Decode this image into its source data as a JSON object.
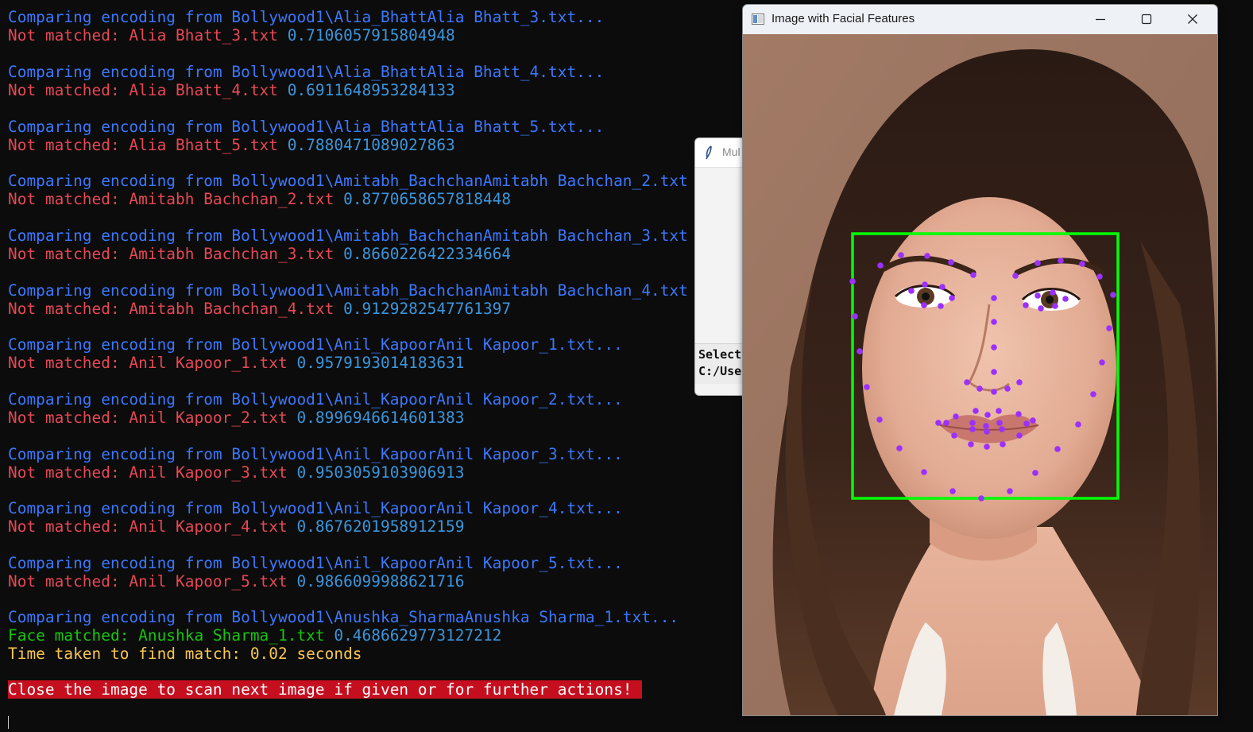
{
  "terminal": {
    "lines": [
      {
        "label": "Comparing encoding from Bollywood1\\Alia_BhattAlia Bhatt_3.txt...",
        "kind": "compare"
      },
      {
        "label": "Not matched: Alia Bhatt_3.txt",
        "value": "0.7106057915804948",
        "kind": "nomatch"
      },
      {
        "label": "Comparing encoding from Bollywood1\\Alia_BhattAlia Bhatt_4.txt...",
        "kind": "compare"
      },
      {
        "label": "Not matched: Alia Bhatt_4.txt",
        "value": "0.6911648953284133",
        "kind": "nomatch"
      },
      {
        "label": "Comparing encoding from Bollywood1\\Alia_BhattAlia Bhatt_5.txt...",
        "kind": "compare"
      },
      {
        "label": "Not matched: Alia Bhatt_5.txt",
        "value": "0.7880471089027863",
        "kind": "nomatch"
      },
      {
        "label": "Comparing encoding from Bollywood1\\Amitabh_BachchanAmitabh Bachchan_2.txt",
        "kind": "compare"
      },
      {
        "label": "Not matched: Amitabh Bachchan_2.txt",
        "value": "0.8770658657818448",
        "kind": "nomatch"
      },
      {
        "label": "Comparing encoding from Bollywood1\\Amitabh_BachchanAmitabh Bachchan_3.txt",
        "kind": "compare"
      },
      {
        "label": "Not matched: Amitabh Bachchan_3.txt",
        "value": "0.8660226422334664",
        "kind": "nomatch"
      },
      {
        "label": "Comparing encoding from Bollywood1\\Amitabh_BachchanAmitabh Bachchan_4.txt",
        "kind": "compare"
      },
      {
        "label": "Not matched: Amitabh Bachchan_4.txt",
        "value": "0.9129282547761397",
        "kind": "nomatch"
      },
      {
        "label": "Comparing encoding from Bollywood1\\Anil_KapoorAnil Kapoor_1.txt...",
        "kind": "compare"
      },
      {
        "label": "Not matched: Anil Kapoor_1.txt",
        "value": "0.9579193014183631",
        "kind": "nomatch"
      },
      {
        "label": "Comparing encoding from Bollywood1\\Anil_KapoorAnil Kapoor_2.txt...",
        "kind": "compare"
      },
      {
        "label": "Not matched: Anil Kapoor_2.txt",
        "value": "0.8996946614601383",
        "kind": "nomatch"
      },
      {
        "label": "Comparing encoding from Bollywood1\\Anil_KapoorAnil Kapoor_3.txt...",
        "kind": "compare"
      },
      {
        "label": "Not matched: Anil Kapoor_3.txt",
        "value": "0.9503059103906913",
        "kind": "nomatch"
      },
      {
        "label": "Comparing encoding from Bollywood1\\Anil_KapoorAnil Kapoor_4.txt...",
        "kind": "compare"
      },
      {
        "label": "Not matched: Anil Kapoor_4.txt",
        "value": "0.8676201958912159",
        "kind": "nomatch"
      },
      {
        "label": "Comparing encoding from Bollywood1\\Anil_KapoorAnil Kapoor_5.txt...",
        "kind": "compare"
      },
      {
        "label": "Not matched: Anil Kapoor_5.txt",
        "value": "0.9866099988621716",
        "kind": "nomatch"
      },
      {
        "label": "Comparing encoding from Bollywood1\\Anushka_SharmaAnushka Sharma_1.txt...",
        "kind": "compare"
      },
      {
        "label": "Face matched: Anushka Sharma_1.txt",
        "value": "0.4686629773127212",
        "kind": "match"
      },
      {
        "label": "Time taken to find match: 0.02 seconds",
        "kind": "time"
      },
      {
        "label": "Close the image to scan next image if given or for further actions!",
        "kind": "banner"
      }
    ]
  },
  "background_dialog": {
    "title": "Mul",
    "content_line1": "Select",
    "content_line2": "C:/Use"
  },
  "image_window": {
    "title": "Image with Facial Features",
    "app_icon": "picture-icon",
    "controls": [
      "minimize-icon",
      "maximize-icon",
      "close-icon"
    ],
    "bounding_box_color": "#00ff00",
    "landmark_color": "#9b30ff"
  },
  "colors": {
    "terminal_bg": "#0c0c0c",
    "compare_text": "#3b78ff",
    "nomatch_text": "#e74856",
    "value_text": "#3a96dd",
    "match_text": "#16c60c",
    "time_text": "#f9c74f",
    "banner_bg": "#c50f1f"
  }
}
